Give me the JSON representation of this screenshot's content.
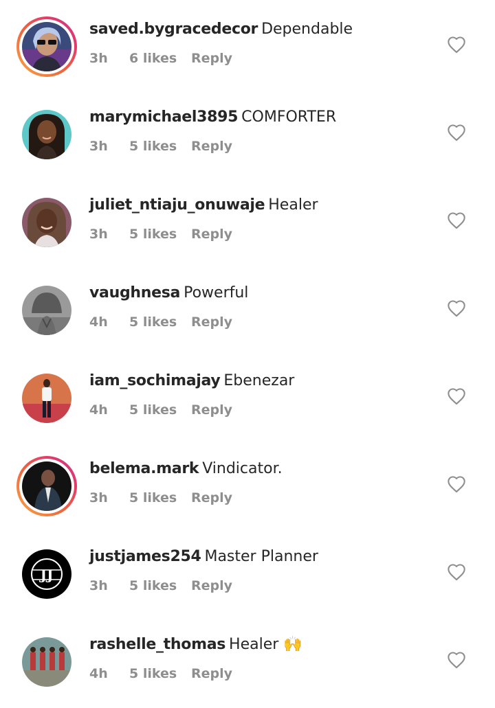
{
  "comments": [
    {
      "username": "saved.bygracedecor",
      "text": "Dependable",
      "time": "3h",
      "likes": "6 likes",
      "reply": "Reply",
      "has_story": true,
      "like_icon": "heart-outline-icon"
    },
    {
      "username": "marymichael3895",
      "text": "COMFORTER",
      "time": "3h",
      "likes": "5 likes",
      "reply": "Reply",
      "has_story": false,
      "like_icon": "heart-outline-icon"
    },
    {
      "username": "juliet_ntiaju_onuwaje",
      "text": "Healer",
      "time": "3h",
      "likes": "5 likes",
      "reply": "Reply",
      "has_story": false,
      "like_icon": "heart-outline-icon"
    },
    {
      "username": "vaughnesa",
      "text": "Powerful",
      "time": "4h",
      "likes": "5 likes",
      "reply": "Reply",
      "has_story": false,
      "like_icon": "heart-outline-icon"
    },
    {
      "username": "iam_sochimajay",
      "text": "Ebenezar",
      "time": "4h",
      "likes": "5 likes",
      "reply": "Reply",
      "has_story": false,
      "like_icon": "heart-outline-icon"
    },
    {
      "username": "belema.mark",
      "text": "Vindicator.",
      "time": "3h",
      "likes": "5 likes",
      "reply": "Reply",
      "has_story": true,
      "like_icon": "heart-outline-icon"
    },
    {
      "username": "justjames254",
      "text": "Master Planner",
      "time": "3h",
      "likes": "5 likes",
      "reply": "Reply",
      "has_story": false,
      "like_icon": "heart-outline-icon"
    },
    {
      "username": "rashelle_thomas",
      "text": "Healer 🙌",
      "time": "4h",
      "likes": "5 likes",
      "reply": "Reply",
      "has_story": false,
      "like_icon": "heart-outline-icon"
    }
  ],
  "avatar_logo_text": "JJ",
  "colors": {
    "username": "#262626",
    "meta": "#8e8e8e",
    "heart": "#8e8e8e",
    "story_ring_start": "#f7a94a",
    "story_ring_end": "#c53a8f"
  }
}
